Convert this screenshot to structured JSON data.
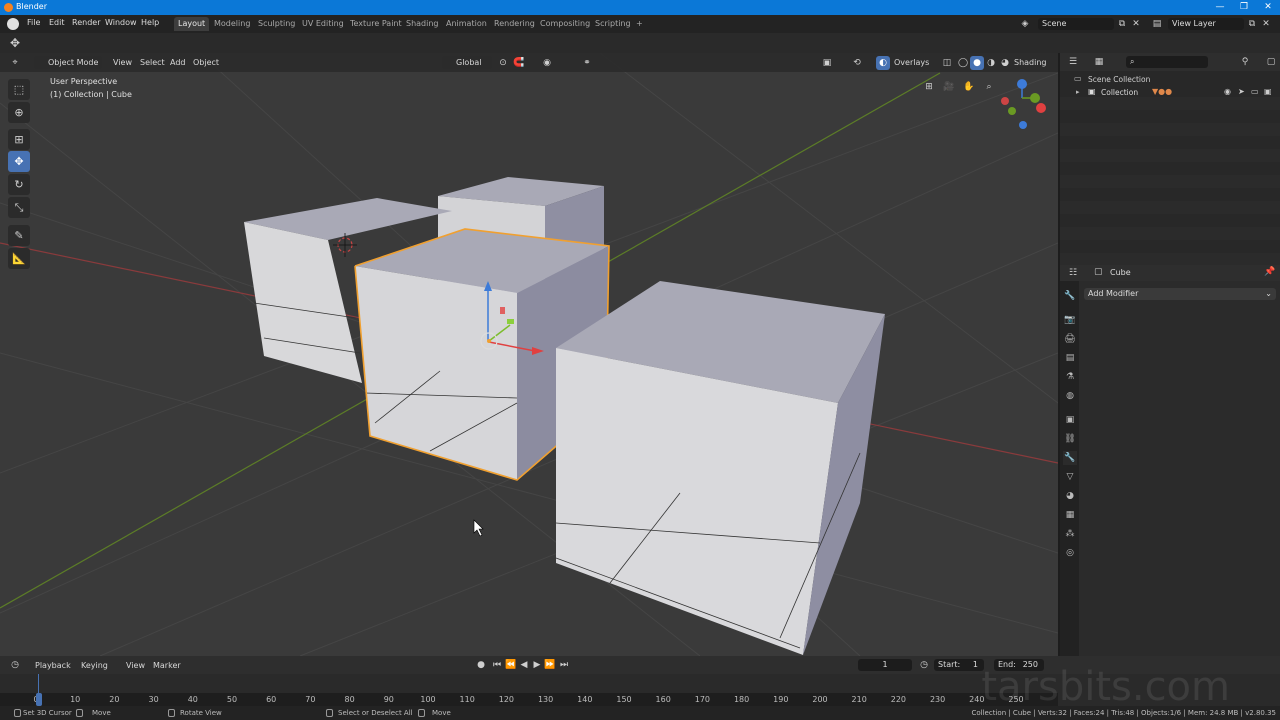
{
  "titlebar": {
    "title": "Blender",
    "minimize": "—",
    "maximize": "❐",
    "close": "✕"
  },
  "menu": {
    "file": "File",
    "edit": "Edit",
    "render": "Render",
    "window": "Window",
    "help": "Help"
  },
  "workspaces": [
    "Layout",
    "Modeling",
    "Sculpting",
    "UV Editing",
    "Texture Paint",
    "Shading",
    "Animation",
    "Rendering",
    "Compositing",
    "Scripting",
    "+"
  ],
  "scene": {
    "name": "Scene",
    "view_layer": "View Layer"
  },
  "viewport": {
    "mode": "Object Mode",
    "menus": [
      "View",
      "Select",
      "Add",
      "Object"
    ],
    "orientation": "Global",
    "overlays": "Overlays",
    "shading": "Shading",
    "perspective_label": "User Perspective",
    "collection_label": "(1) Collection | Cube"
  },
  "outliner": {
    "scene_collection": "Scene Collection",
    "collection": "Collection"
  },
  "properties": {
    "object_name": "Cube",
    "add_modifier": "Add Modifier"
  },
  "timeline": {
    "menus": [
      "Playback",
      "Keying",
      "View",
      "Marker"
    ],
    "current_frame": "1",
    "start_label": "Start:",
    "start": "1",
    "end_label": "End:",
    "end": "250",
    "ticks": [
      "0",
      "10",
      "20",
      "30",
      "40",
      "50",
      "60",
      "70",
      "80",
      "90",
      "100",
      "110",
      "120",
      "130",
      "140",
      "150",
      "160",
      "170",
      "180",
      "190",
      "200",
      "210",
      "220",
      "230",
      "240",
      "250"
    ]
  },
  "status": {
    "left1": "Set 3D Cursor",
    "left2": "Move",
    "left3": "Rotate View",
    "mid1": "Select or Deselect All",
    "mid2": "Move",
    "right": "Collection | Cube | Verts:32 | Faces:24 | Tris:48 | Objects:1/6 | Mem: 24.8 MB | v2.80.35"
  },
  "watermark": "tarsbits.com",
  "colors": {
    "selection_outline": "#f0a030",
    "accent": "#4772b3",
    "x_axis": "#c0393b",
    "y_axis": "#6a9a23"
  }
}
